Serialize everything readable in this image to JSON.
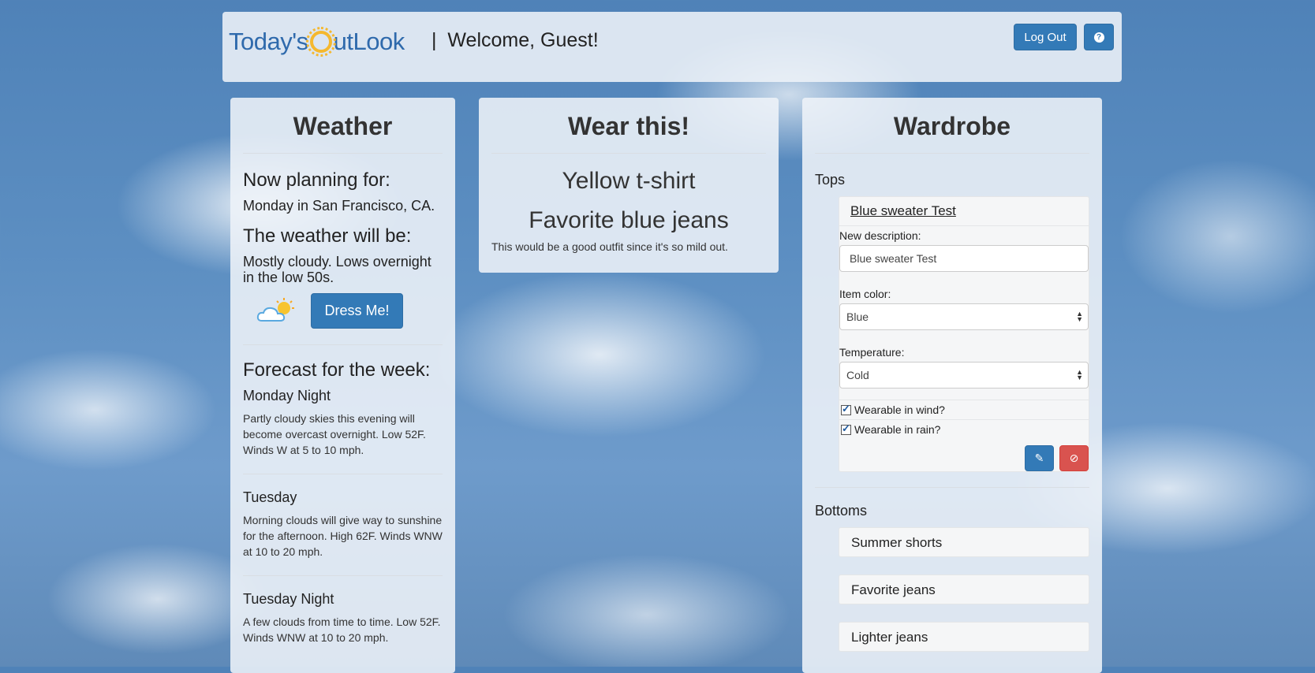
{
  "navbar": {
    "logo_part1": "Today's",
    "logo_part2": "utLook",
    "separator": "|",
    "welcome": "Welcome, Guest!",
    "logout_label": "Log Out",
    "help_label": "?"
  },
  "weather": {
    "title": "Weather",
    "planning_heading": "Now planning for:",
    "planning_value": "Monday in San Francisco, CA.",
    "weather_heading": "The weather will be:",
    "weather_value": "Mostly cloudy. Lows overnight in the low 50s.",
    "dress_button": "Dress Me!",
    "forecast_heading": "Forecast for the week:",
    "forecast": [
      {
        "day": "Monday Night",
        "text": "Partly cloudy skies this evening will become overcast overnight. Low 52F. Winds W at 5 to 10 mph."
      },
      {
        "day": "Tuesday",
        "text": "Morning clouds will give way to sunshine for the afternoon. High 62F. Winds WNW at 10 to 20 mph."
      },
      {
        "day": "Tuesday Night",
        "text": "A few clouds from time to time. Low 52F. Winds WNW at 10 to 20 mph."
      }
    ]
  },
  "wear": {
    "title": "Wear this!",
    "items": [
      "Yellow t-shirt",
      "Favorite blue jeans"
    ],
    "note": "This would be a good outfit since it's so mild out."
  },
  "wardrobe": {
    "title": "Wardrobe",
    "tops_label": "Tops",
    "edit_item": {
      "name": "Blue sweater Test",
      "description_label": "New description:",
      "description_value": "Blue sweater Test",
      "color_label": "Item color:",
      "color_value": "Blue",
      "temperature_label": "Temperature:",
      "temperature_value": "Cold",
      "wind_label": "Wearable in wind?",
      "rain_label": "Wearable in rain?",
      "wind_checked": true,
      "rain_checked": true
    },
    "bottoms_label": "Bottoms",
    "bottoms": [
      "Summer shorts",
      "Favorite jeans",
      "Lighter jeans"
    ]
  },
  "icons": {
    "weather_icon": "partly-cloudy-icon",
    "edit_icon": "pencil-icon",
    "delete_icon": "ban-icon",
    "help_icon": "question-circle-icon"
  },
  "colors": {
    "primary": "#337ab7",
    "danger": "#d9534f",
    "logo_blue": "#2f6aac",
    "sun_yellow": "#f5b82e"
  }
}
